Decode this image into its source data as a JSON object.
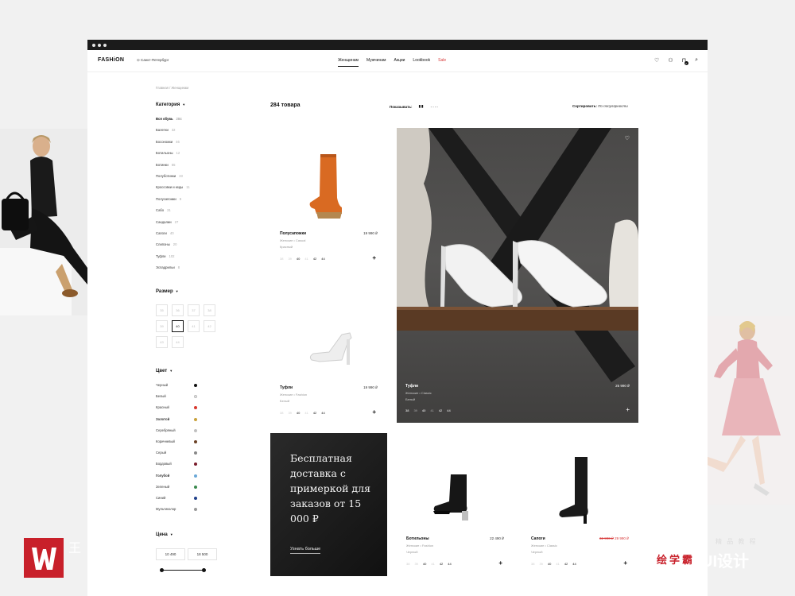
{
  "header": {
    "logo": "FASHiON",
    "city": "Санкт-Петербург",
    "nav": [
      {
        "label": "Женщинам",
        "active": true
      },
      {
        "label": "Мужчинам"
      },
      {
        "label": "Акции"
      },
      {
        "label": "Lookbook"
      },
      {
        "label": "Sale",
        "sale": true
      }
    ],
    "cart_count": "2"
  },
  "breadcrumb": "Главная / Женщинам",
  "filters": {
    "category_title": "Категория",
    "categories": [
      {
        "name": "Вся обувь",
        "count": "284"
      },
      {
        "name": "Балетки",
        "count": "32"
      },
      {
        "name": "Босоножки",
        "count": "46"
      },
      {
        "name": "Ботильоны",
        "count": "12"
      },
      {
        "name": "Ботинки",
        "count": "65"
      },
      {
        "name": "Полуботинки",
        "count": "23"
      },
      {
        "name": "Кроссовки и кеды",
        "count": "11"
      },
      {
        "name": "Полусапожки",
        "count": "9"
      },
      {
        "name": "Сабо",
        "count": "31"
      },
      {
        "name": "Сандалии",
        "count": "27"
      },
      {
        "name": "Сапоги",
        "count": "40"
      },
      {
        "name": "Слипоны",
        "count": "20"
      },
      {
        "name": "Туфли",
        "count": "102"
      },
      {
        "name": "Эспадрильи",
        "count": "8"
      }
    ],
    "size_title": "Размер",
    "sizes": [
      "35",
      "36",
      "37",
      "38",
      "39",
      "40",
      "41",
      "42",
      "43",
      "44"
    ],
    "selected_size": "40",
    "color_title": "Цвет",
    "colors": [
      {
        "name": "Черный",
        "hex": "#111111"
      },
      {
        "name": "Белый",
        "hex": "#e8e8e8"
      },
      {
        "name": "Красный",
        "hex": "#d8382e"
      },
      {
        "name": "Золотой",
        "hex": "#c9a23c",
        "bold": true
      },
      {
        "name": "Серебряный",
        "hex": "#c0c0c0"
      },
      {
        "name": "Коричневый",
        "hex": "#6b4226"
      },
      {
        "name": "Серый",
        "hex": "#888888"
      },
      {
        "name": "Бордовый",
        "hex": "#7a1d2c"
      },
      {
        "name": "Голубой",
        "hex": "#6aa8d8",
        "bold": true
      },
      {
        "name": "Зеленый",
        "hex": "#3b8a4e"
      },
      {
        "name": "Синий",
        "hex": "#1f3f8a"
      },
      {
        "name": "Мультиколор",
        "hex": "#999999"
      }
    ],
    "price_title": "Цена",
    "price_from": "10 490",
    "price_to": "18 500"
  },
  "toolbar": {
    "count": "284 товара",
    "show_label": "Показывать:",
    "sort_label": "Сортировать:",
    "sort_value": "По популярности"
  },
  "products": [
    {
      "name": "Полусапожки",
      "price": "19 990 ₽",
      "line": "Женские • Casual",
      "color": "Красный",
      "sizes": [
        "38",
        "39",
        "40",
        "41",
        "42",
        "44"
      ],
      "available": [
        "40",
        "42",
        "44"
      ]
    },
    {
      "name": "Туфли",
      "price": "19 990 ₽",
      "line": "Женские • Fashion",
      "color": "Белый",
      "sizes": [
        "38",
        "39",
        "40",
        "41",
        "42",
        "44"
      ],
      "available": [
        "40",
        "42",
        "44"
      ]
    },
    {
      "name": "Туфли",
      "price": "25 990 ₽",
      "line": "Женские • Classic",
      "color": "Белый",
      "sizes": [
        "38",
        "39",
        "40",
        "41",
        "42",
        "44"
      ],
      "available": [
        "38",
        "40",
        "42",
        "44"
      ]
    },
    {
      "name": "Ботильоны",
      "price": "22 490 ₽",
      "line": "Женские • Fashion",
      "color": "Черный",
      "sizes": [
        "38",
        "39",
        "40",
        "41",
        "42",
        "44"
      ],
      "available": [
        "40",
        "42",
        "44"
      ]
    },
    {
      "name": "Сапоги",
      "price": "29 990 ₽",
      "old_price": "32 990 ₽",
      "line": "Женские • Classic",
      "color": "Черный",
      "sizes": [
        "38",
        "39",
        "40",
        "41",
        "42",
        "44"
      ],
      "available": [
        "40",
        "42",
        "44"
      ]
    }
  ],
  "promo": {
    "text": "Бесплатная доставка с примеркой для заказов от 15 000 ₽",
    "link": "Узнать больше"
  },
  "watermark": {
    "left_chars": "王",
    "brand": "绘学霸",
    "right": "UI设计",
    "tag": "精 品 教 程"
  }
}
